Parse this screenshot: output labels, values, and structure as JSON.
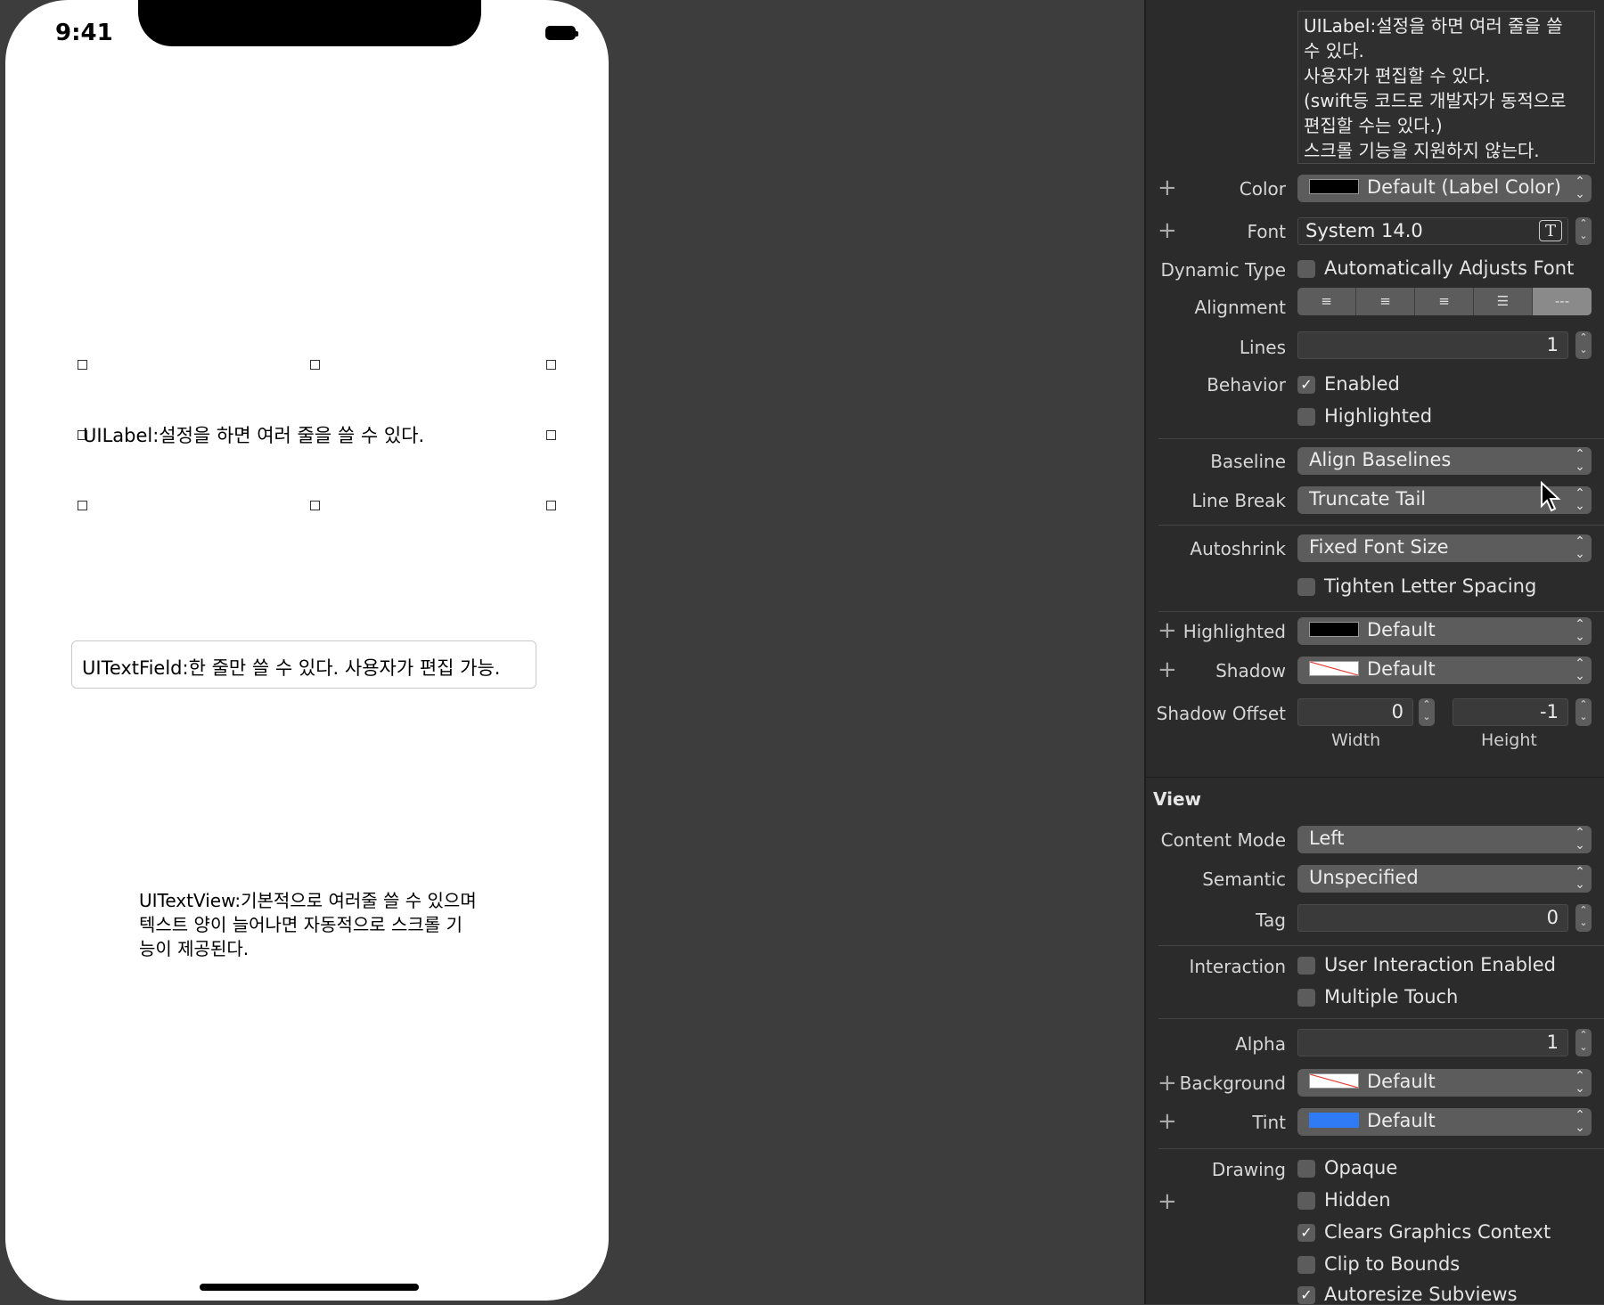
{
  "status_bar": {
    "time": "9:41"
  },
  "canvas": {
    "label_text": "UILabel:설정을 하면 여러 줄을 쓸 수 있다.",
    "textfield_text": "UITextField:한 줄만 쓸 수 있다. 사용자가 편집 가능.",
    "textview_text": "UITextView:기본적으로 여러줄 쓸 수 있으며 텍스트 양이 늘어나면 자동적으로 스크롤 기능이 제공된다."
  },
  "inspector": {
    "text_value_lines": [
      "UILabel:설정을 하면 여러 줄을 쓸",
      "수 있다.",
      "사용자가 편집할 수 있다.",
      "(swift등 코드로 개발자가 동적으로",
      "편집할 수는 있다.)",
      "스크롤 기능을 지원하지 않는다."
    ],
    "color": {
      "label": "Color",
      "value": "Default (Label Color)",
      "swatch": "#000000"
    },
    "font": {
      "label": "Font",
      "value": "System 14.0",
      "font_icon": "T"
    },
    "dynamic_type": {
      "label": "Dynamic Type",
      "option": "Automatically Adjusts Font",
      "checked": false
    },
    "alignment": {
      "label": "Alignment",
      "segments": [
        "left-align-icon",
        "center-align-icon",
        "right-align-icon",
        "justify-align-icon",
        "natural-align-icon"
      ],
      "selected": 4
    },
    "lines": {
      "label": "Lines",
      "value": "1"
    },
    "behavior": {
      "label": "Behavior",
      "enabled": "Enabled",
      "enabled_checked": true,
      "highlighted": "Highlighted",
      "highlighted_checked": false
    },
    "baseline": {
      "label": "Baseline",
      "value": "Align Baselines"
    },
    "line_break": {
      "label": "Line Break",
      "value": "Truncate Tail"
    },
    "autoshrink": {
      "label": "Autoshrink",
      "value": "Fixed Font Size"
    },
    "tighten": {
      "label": "Tighten Letter Spacing",
      "checked": false
    },
    "highlighted_color": {
      "label": "Highlighted",
      "value": "Default",
      "swatch": "#000000"
    },
    "shadow": {
      "label": "Shadow",
      "value": "Default"
    },
    "shadow_offset": {
      "label": "Shadow Offset",
      "width": "0",
      "height": "-1",
      "width_label": "Width",
      "height_label": "Height"
    },
    "view": {
      "header": "View",
      "content_mode": {
        "label": "Content Mode",
        "value": "Left"
      },
      "semantic": {
        "label": "Semantic",
        "value": "Unspecified"
      },
      "tag": {
        "label": "Tag",
        "value": "0"
      },
      "interaction": {
        "label": "Interaction",
        "user_interaction": "User Interaction Enabled",
        "multiple_touch": "Multiple Touch"
      },
      "alpha": {
        "label": "Alpha",
        "value": "1"
      },
      "background": {
        "label": "Background",
        "value": "Default"
      },
      "tint": {
        "label": "Tint",
        "value": "Default",
        "swatch": "#2f7bf5"
      },
      "drawing": {
        "label": "Drawing",
        "opaque": "Opaque",
        "hidden": "Hidden",
        "clears": "Clears Graphics Context",
        "clip": "Clip to Bounds",
        "autoresize": "Autoresize Subviews"
      }
    }
  },
  "plus_glyph": "+",
  "check_glyph": "✓",
  "popup_chevron": "⌃⌄"
}
